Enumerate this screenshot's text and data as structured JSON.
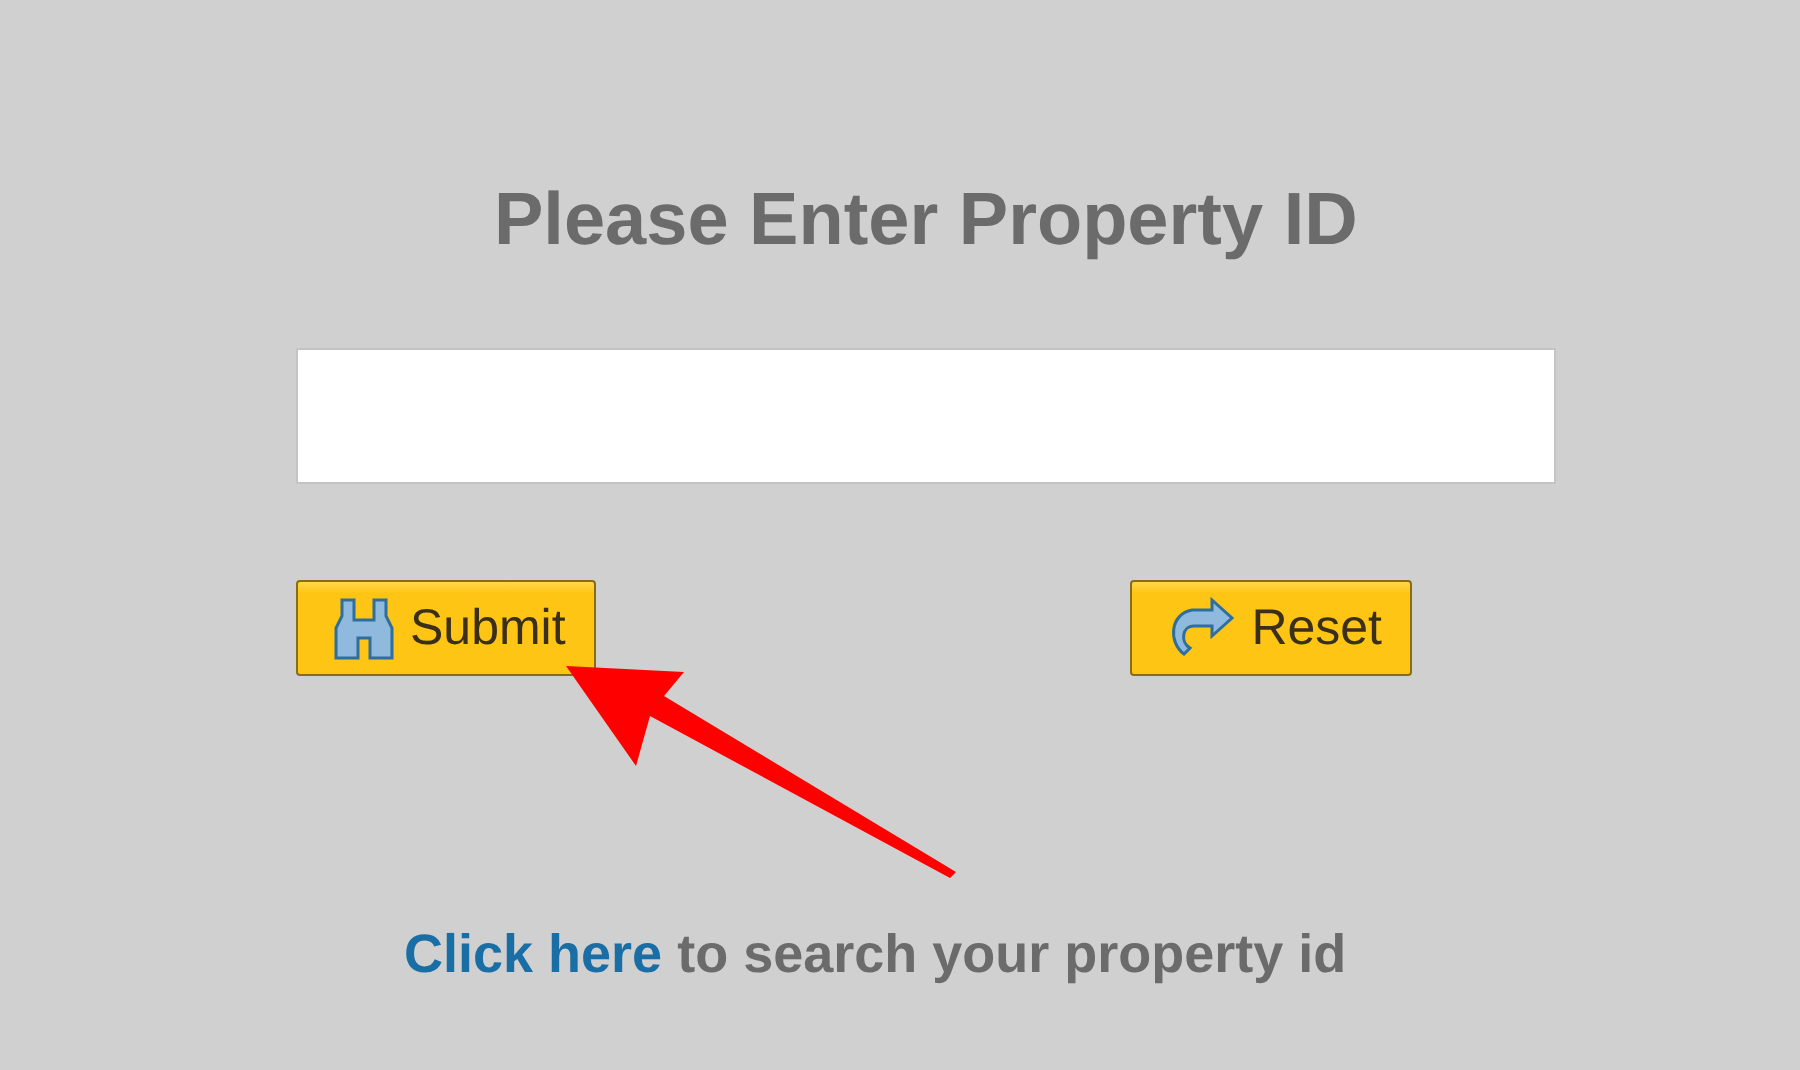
{
  "title": "Please Enter Property ID",
  "buttons": [
    {
      "kind": "submit",
      "label": "Submit"
    },
    {
      "kind": "reset",
      "label": "Reset"
    }
  ],
  "search_hint": {
    "link": "Click here",
    "text": "to search your property id"
  }
}
